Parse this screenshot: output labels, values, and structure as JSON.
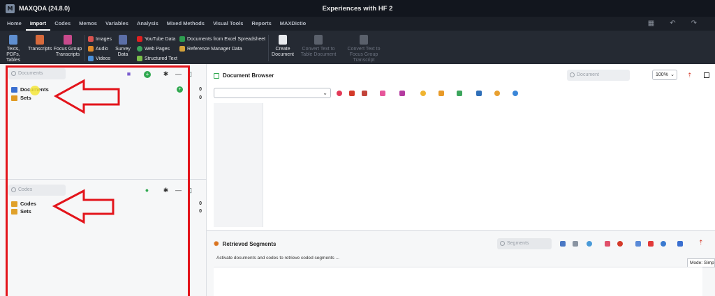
{
  "titlebar": {
    "app_title": "MAXQDA (24.8.0)",
    "doc_title": "Experiences with HF 2",
    "logo_letter": "M"
  },
  "menu": {
    "tabs": [
      {
        "label": "Home"
      },
      {
        "label": "Import",
        "active": true
      },
      {
        "label": "Codes"
      },
      {
        "label": "Memos"
      },
      {
        "label": "Variables"
      },
      {
        "label": "Analysis"
      },
      {
        "label": "Mixed Methods"
      },
      {
        "label": "Visual Tools"
      },
      {
        "label": "Reports"
      },
      {
        "label": "MAXDictio"
      }
    ]
  },
  "ribbon": {
    "texts_pdfs_tables": "Texts, PDFs, Tables",
    "transcripts": "Transcripts",
    "focus_group_transcripts": "Focus Group Transcripts",
    "images": "Images",
    "audio": "Audio",
    "videos": "Videos",
    "survey_data": "Survey Data",
    "youtube_data": "YouTube Data",
    "web_pages": "Web Pages",
    "structured_text": "Structured Text",
    "documents_from_excel": "Documents from Excel Spreadsheet",
    "reference_manager_data": "Reference Manager Data",
    "create_document": "Create Document",
    "convert_text_to_table": "Convert Text to Table Document",
    "convert_text_to_focus": "Convert Text to Focus Group Transcript"
  },
  "documents_panel": {
    "search_placeholder": "Documents",
    "items": [
      {
        "label": "Documents",
        "count": "0"
      },
      {
        "label": "Sets",
        "count": "0"
      }
    ]
  },
  "codes_panel": {
    "search_placeholder": "Codes",
    "items": [
      {
        "label": "Codes",
        "count": "0"
      },
      {
        "label": "Sets",
        "count": "0"
      }
    ]
  },
  "document_browser": {
    "title": "Document Browser",
    "search_placeholder": "Document",
    "zoom": "100%"
  },
  "retrieved_segments": {
    "title": "Retrieved Segments",
    "search_placeholder": "Segments",
    "message": "Activate documents and codes to retrieve coded segments ...",
    "mode": "Mode: Simp"
  },
  "colors": {
    "annotation_red": "#e3141b",
    "titlebar": "#12161e",
    "ribbon": "#252a33"
  }
}
